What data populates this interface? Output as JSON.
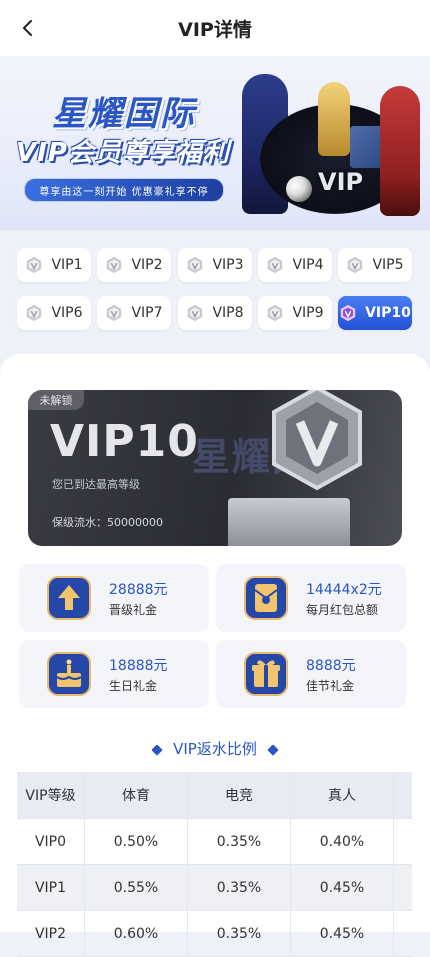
{
  "header": {
    "title": "VIP详情"
  },
  "banner": {
    "title_line1": "星耀国际",
    "title_line2": "VIP会员尊享福利",
    "slogan": "尊享由这一刻开始 优惠豪礼享不停",
    "vip_mark": "VIP"
  },
  "levels": [
    "VIP1",
    "VIP2",
    "VIP3",
    "VIP4",
    "VIP5",
    "VIP6",
    "VIP7",
    "VIP8",
    "VIP9",
    "VIP10"
  ],
  "selected_level": "VIP10",
  "vip_card": {
    "status": "未解锁",
    "level": "VIP10",
    "subtitle": "您已到达最高等级",
    "turnover": "保级流水：50000000"
  },
  "perks": [
    {
      "amount": "28888元",
      "label": "晋级礼金",
      "icon": "arrow-up-icon"
    },
    {
      "amount": "14444x2元",
      "label": "每月红包总额",
      "icon": "red-envelope-icon"
    },
    {
      "amount": "18888元",
      "label": "生日礼金",
      "icon": "cake-icon"
    },
    {
      "amount": "8888元",
      "label": "佳节礼金",
      "icon": "gift-icon"
    }
  ],
  "rebate_section": {
    "title": "VIP返水比例"
  },
  "rebate_table": {
    "headers": [
      "VIP等级",
      "体育",
      "电竞",
      "真人"
    ],
    "rows": [
      [
        "VIP0",
        "0.50%",
        "0.35%",
        "0.40%"
      ],
      [
        "VIP1",
        "0.55%",
        "0.35%",
        "0.45%"
      ],
      [
        "VIP2",
        "0.60%",
        "0.35%",
        "0.45%"
      ]
    ]
  },
  "colors": {
    "accent": "#2a55c5",
    "active_level": "#2f5fe0",
    "card_dark": "#2b2c33"
  }
}
